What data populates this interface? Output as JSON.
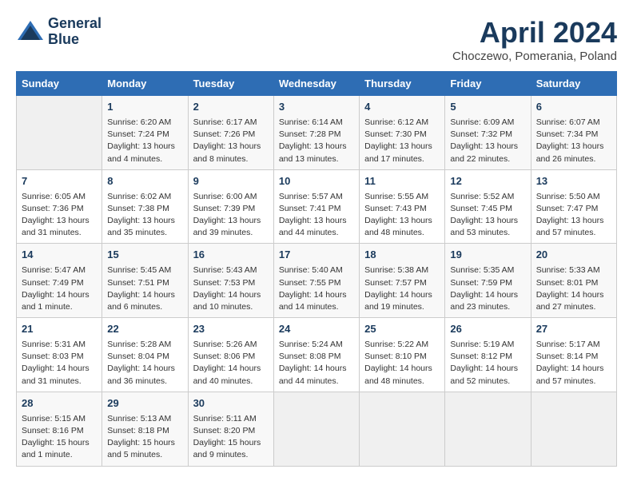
{
  "app": {
    "logo_line1": "General",
    "logo_line2": "Blue"
  },
  "header": {
    "month_year": "April 2024",
    "location": "Choczewo, Pomerania, Poland"
  },
  "days_of_week": [
    "Sunday",
    "Monday",
    "Tuesday",
    "Wednesday",
    "Thursday",
    "Friday",
    "Saturday"
  ],
  "weeks": [
    [
      {
        "num": "",
        "info": ""
      },
      {
        "num": "1",
        "info": "Sunrise: 6:20 AM\nSunset: 7:24 PM\nDaylight: 13 hours\nand 4 minutes."
      },
      {
        "num": "2",
        "info": "Sunrise: 6:17 AM\nSunset: 7:26 PM\nDaylight: 13 hours\nand 8 minutes."
      },
      {
        "num": "3",
        "info": "Sunrise: 6:14 AM\nSunset: 7:28 PM\nDaylight: 13 hours\nand 13 minutes."
      },
      {
        "num": "4",
        "info": "Sunrise: 6:12 AM\nSunset: 7:30 PM\nDaylight: 13 hours\nand 17 minutes."
      },
      {
        "num": "5",
        "info": "Sunrise: 6:09 AM\nSunset: 7:32 PM\nDaylight: 13 hours\nand 22 minutes."
      },
      {
        "num": "6",
        "info": "Sunrise: 6:07 AM\nSunset: 7:34 PM\nDaylight: 13 hours\nand 26 minutes."
      }
    ],
    [
      {
        "num": "7",
        "info": "Sunrise: 6:05 AM\nSunset: 7:36 PM\nDaylight: 13 hours\nand 31 minutes."
      },
      {
        "num": "8",
        "info": "Sunrise: 6:02 AM\nSunset: 7:38 PM\nDaylight: 13 hours\nand 35 minutes."
      },
      {
        "num": "9",
        "info": "Sunrise: 6:00 AM\nSunset: 7:39 PM\nDaylight: 13 hours\nand 39 minutes."
      },
      {
        "num": "10",
        "info": "Sunrise: 5:57 AM\nSunset: 7:41 PM\nDaylight: 13 hours\nand 44 minutes."
      },
      {
        "num": "11",
        "info": "Sunrise: 5:55 AM\nSunset: 7:43 PM\nDaylight: 13 hours\nand 48 minutes."
      },
      {
        "num": "12",
        "info": "Sunrise: 5:52 AM\nSunset: 7:45 PM\nDaylight: 13 hours\nand 53 minutes."
      },
      {
        "num": "13",
        "info": "Sunrise: 5:50 AM\nSunset: 7:47 PM\nDaylight: 13 hours\nand 57 minutes."
      }
    ],
    [
      {
        "num": "14",
        "info": "Sunrise: 5:47 AM\nSunset: 7:49 PM\nDaylight: 14 hours\nand 1 minute."
      },
      {
        "num": "15",
        "info": "Sunrise: 5:45 AM\nSunset: 7:51 PM\nDaylight: 14 hours\nand 6 minutes."
      },
      {
        "num": "16",
        "info": "Sunrise: 5:43 AM\nSunset: 7:53 PM\nDaylight: 14 hours\nand 10 minutes."
      },
      {
        "num": "17",
        "info": "Sunrise: 5:40 AM\nSunset: 7:55 PM\nDaylight: 14 hours\nand 14 minutes."
      },
      {
        "num": "18",
        "info": "Sunrise: 5:38 AM\nSunset: 7:57 PM\nDaylight: 14 hours\nand 19 minutes."
      },
      {
        "num": "19",
        "info": "Sunrise: 5:35 AM\nSunset: 7:59 PM\nDaylight: 14 hours\nand 23 minutes."
      },
      {
        "num": "20",
        "info": "Sunrise: 5:33 AM\nSunset: 8:01 PM\nDaylight: 14 hours\nand 27 minutes."
      }
    ],
    [
      {
        "num": "21",
        "info": "Sunrise: 5:31 AM\nSunset: 8:03 PM\nDaylight: 14 hours\nand 31 minutes."
      },
      {
        "num": "22",
        "info": "Sunrise: 5:28 AM\nSunset: 8:04 PM\nDaylight: 14 hours\nand 36 minutes."
      },
      {
        "num": "23",
        "info": "Sunrise: 5:26 AM\nSunset: 8:06 PM\nDaylight: 14 hours\nand 40 minutes."
      },
      {
        "num": "24",
        "info": "Sunrise: 5:24 AM\nSunset: 8:08 PM\nDaylight: 14 hours\nand 44 minutes."
      },
      {
        "num": "25",
        "info": "Sunrise: 5:22 AM\nSunset: 8:10 PM\nDaylight: 14 hours\nand 48 minutes."
      },
      {
        "num": "26",
        "info": "Sunrise: 5:19 AM\nSunset: 8:12 PM\nDaylight: 14 hours\nand 52 minutes."
      },
      {
        "num": "27",
        "info": "Sunrise: 5:17 AM\nSunset: 8:14 PM\nDaylight: 14 hours\nand 57 minutes."
      }
    ],
    [
      {
        "num": "28",
        "info": "Sunrise: 5:15 AM\nSunset: 8:16 PM\nDaylight: 15 hours\nand 1 minute."
      },
      {
        "num": "29",
        "info": "Sunrise: 5:13 AM\nSunset: 8:18 PM\nDaylight: 15 hours\nand 5 minutes."
      },
      {
        "num": "30",
        "info": "Sunrise: 5:11 AM\nSunset: 8:20 PM\nDaylight: 15 hours\nand 9 minutes."
      },
      {
        "num": "",
        "info": ""
      },
      {
        "num": "",
        "info": ""
      },
      {
        "num": "",
        "info": ""
      },
      {
        "num": "",
        "info": ""
      }
    ]
  ]
}
